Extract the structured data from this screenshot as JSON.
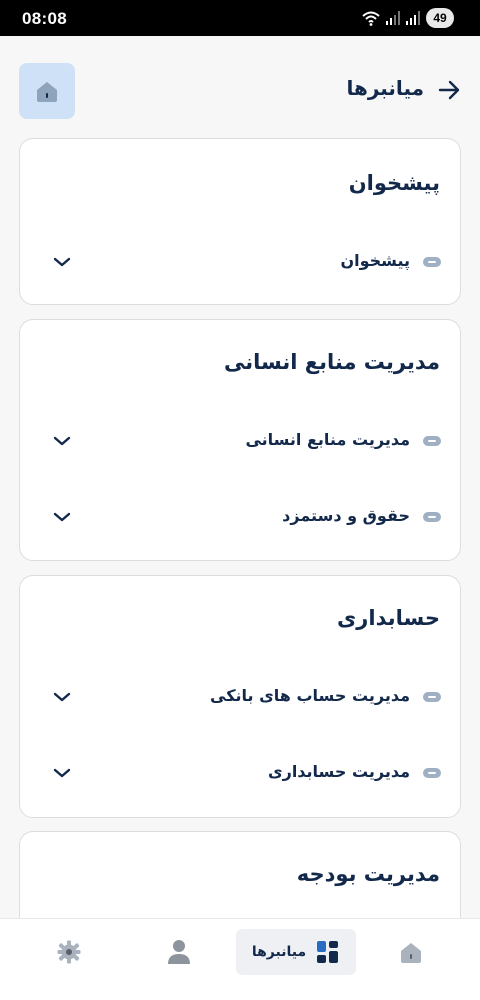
{
  "status_bar": {
    "time": "08:08",
    "battery": "49"
  },
  "header": {
    "title": "میانبرها"
  },
  "sections": [
    {
      "title": "پیشخوان",
      "items": [
        "پیشخوان"
      ]
    },
    {
      "title": "مدیریت منابع انسانی",
      "items": [
        "مدیریت منابع انسانی",
        "حقوق و دستمزد"
      ]
    },
    {
      "title": "حسابداری",
      "items": [
        "مدیریت حساب های بانکی",
        "مدیریت حسابداری"
      ]
    },
    {
      "title": "مدیریت بودجه",
      "items": []
    }
  ],
  "bottom_nav": {
    "active_label": "میانبرها"
  },
  "colors": {
    "primary": "#13294b",
    "accent_light": "#cfe1f6",
    "background": "#f7f7f8"
  }
}
